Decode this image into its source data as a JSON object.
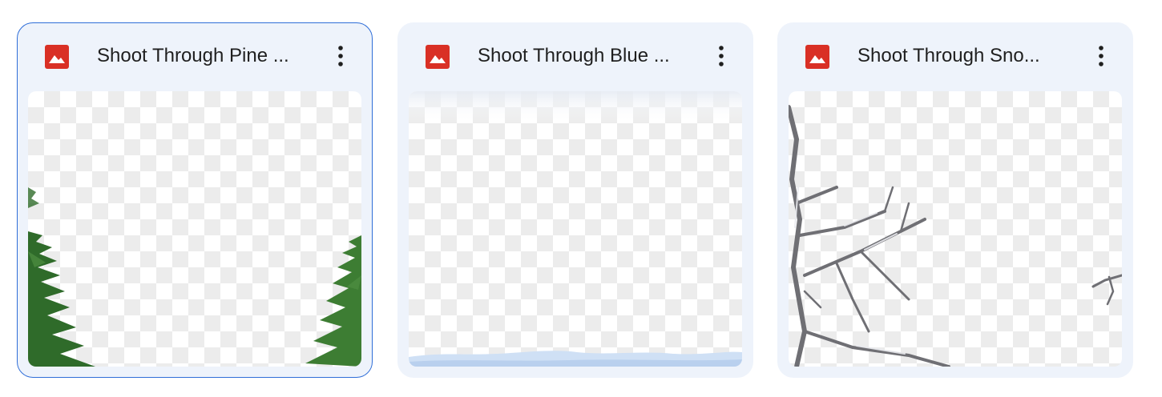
{
  "files": [
    {
      "title": "Shoot Through Pine ...",
      "file_type_icon": "image-file-icon",
      "menu_icon": "more-vert-icon",
      "thumbnail": "transparent image with pine branches at lower edges",
      "selected": true
    },
    {
      "title": "Shoot Through Blue ...",
      "file_type_icon": "image-file-icon",
      "menu_icon": "more-vert-icon",
      "thumbnail": "transparent image with blue snow edge at bottom",
      "selected": false
    },
    {
      "title": "Shoot Through Sno...",
      "file_type_icon": "image-file-icon",
      "menu_icon": "more-vert-icon",
      "thumbnail": "transparent image with snowy bare branches",
      "selected": false
    }
  ],
  "colors": {
    "card_background": "#eef3fb",
    "selected_border": "#2f6ed8",
    "image_icon_red": "#d93025",
    "title_text": "#1f1f1f",
    "pine_green": "#2f6b2a",
    "snow_blue": "#cfe0f5",
    "branch_gray": "#6f6f74"
  }
}
